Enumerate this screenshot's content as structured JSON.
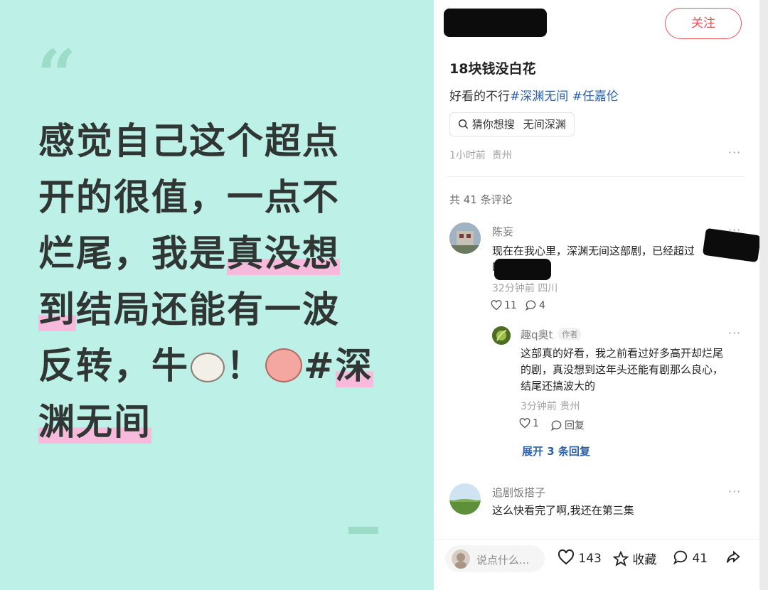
{
  "left_card": {
    "quote_mark": "“",
    "lines": [
      {
        "parts": [
          {
            "text": "感觉自己这个超点",
            "hl": false
          }
        ]
      },
      {
        "parts": [
          {
            "text": "开的很值，一点不",
            "hl": false
          }
        ]
      },
      {
        "parts": [
          {
            "text": "烂尾，我是",
            "hl": false
          },
          {
            "text": "真没想",
            "hl": true
          }
        ]
      },
      {
        "parts": [
          {
            "text": "到",
            "hl": true
          },
          {
            "text": "结局还能有一波",
            "hl": false
          }
        ]
      },
      {
        "parts": [
          {
            "text": "反转，牛",
            "hl": false
          },
          {
            "emoji": "cow"
          },
          {
            "text": "！",
            "hl": false
          },
          {
            "emoji": "pig"
          },
          {
            "text": "#",
            "hl": false
          },
          {
            "text": "深",
            "hl": true
          }
        ]
      },
      {
        "parts": [
          {
            "text": "渊无间",
            "hl": true
          }
        ]
      }
    ]
  },
  "post": {
    "follow_label": "关注",
    "title": "18块钱没白花",
    "desc_text": "好看的不行",
    "tag1": "#深渊无间",
    "tag2": "#任嘉伦",
    "search_chip_label": "猜你想搜",
    "search_chip_query": "无间深渊",
    "time": "1小时前",
    "location": "贵州",
    "more": "···"
  },
  "comments_header": "共 41 条评论",
  "comments": [
    {
      "name": "陈妄",
      "text_line1": "现在在我心里，深渊无间这部剧，已经超过",
      "text_line2": "时了",
      "time": "32分钟前",
      "location": "四川",
      "likes": "11",
      "replies_count": "4"
    }
  ],
  "reply": {
    "name": "趣q奥t",
    "badge": "作者",
    "text_line1": "这部真的好看，我之前看过好多高开却烂尾",
    "text_line2": "的剧，真没想到这年头还能有剧那么良心，",
    "text_line3": "结尾还搞波大的",
    "time": "3分钟前",
    "location": "贵州",
    "likes": "1",
    "reply_label": "回复",
    "expand_label": "展开 3 条回复"
  },
  "comment2": {
    "name": "追剧饭搭子",
    "text": "这么快看完了啊,我还在第三集"
  },
  "bottom_bar": {
    "input_placeholder": "说点什么...",
    "likes": "143",
    "collect_label": "收藏",
    "comments": "41"
  },
  "colors": {
    "mint_bg": "#bdf0e6",
    "highlight": "#f7b9dc",
    "accent_red": "#e8545a",
    "tag_blue": "#2d5fa6"
  }
}
